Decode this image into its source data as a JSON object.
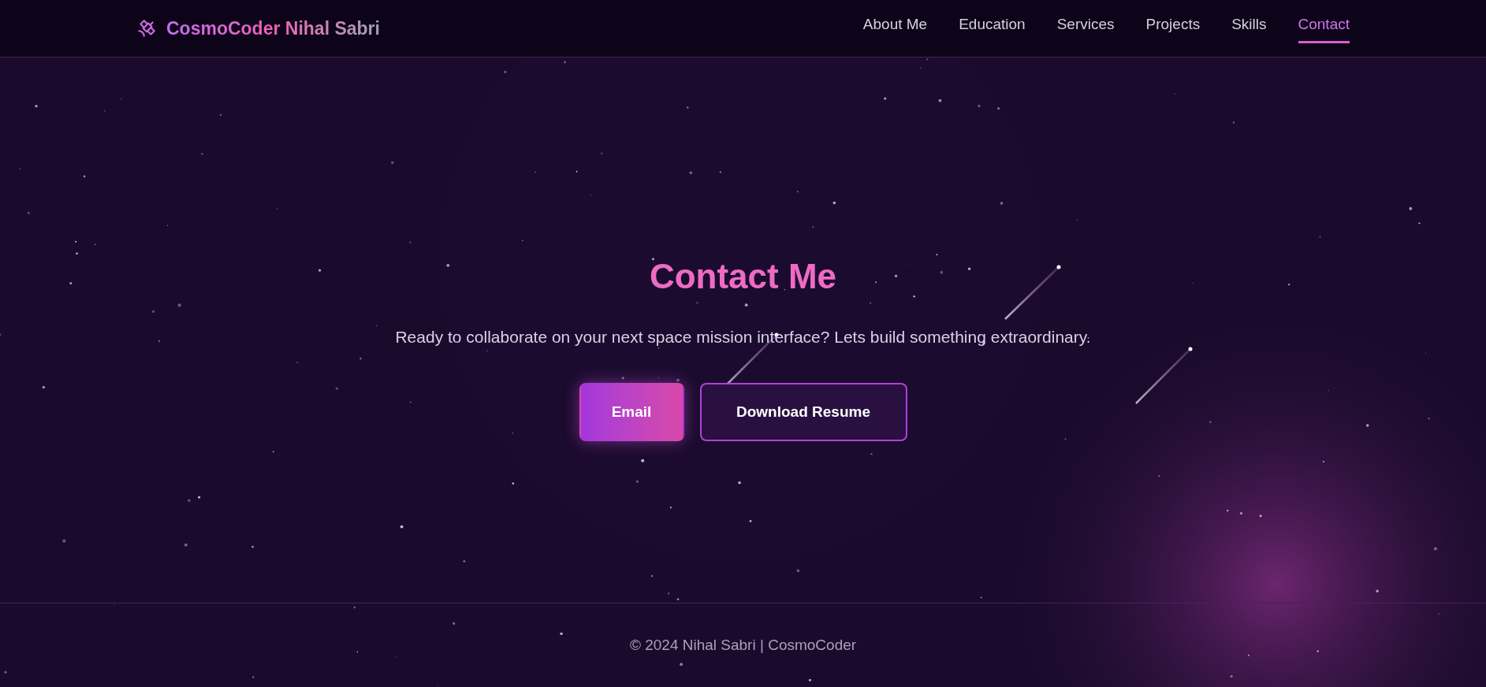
{
  "header": {
    "brand": "CosmoCoder Nihal Sabri",
    "nav": [
      {
        "label": "About Me",
        "selected": false
      },
      {
        "label": "Education",
        "selected": false
      },
      {
        "label": "Services",
        "selected": false
      },
      {
        "label": "Projects",
        "selected": false
      },
      {
        "label": "Skills",
        "selected": false
      },
      {
        "label": "Contact",
        "selected": true
      }
    ]
  },
  "contact": {
    "title": "Contact Me",
    "text": "Ready to collaborate on your next space mission interface? Lets build something extraordinary.",
    "buttons": [
      {
        "label": "Email",
        "kind": "primary"
      },
      {
        "label": "Download Resume",
        "kind": "outline"
      }
    ]
  },
  "footer": {
    "text": "© 2024 Nihal Sabri | CosmoCoder"
  }
}
